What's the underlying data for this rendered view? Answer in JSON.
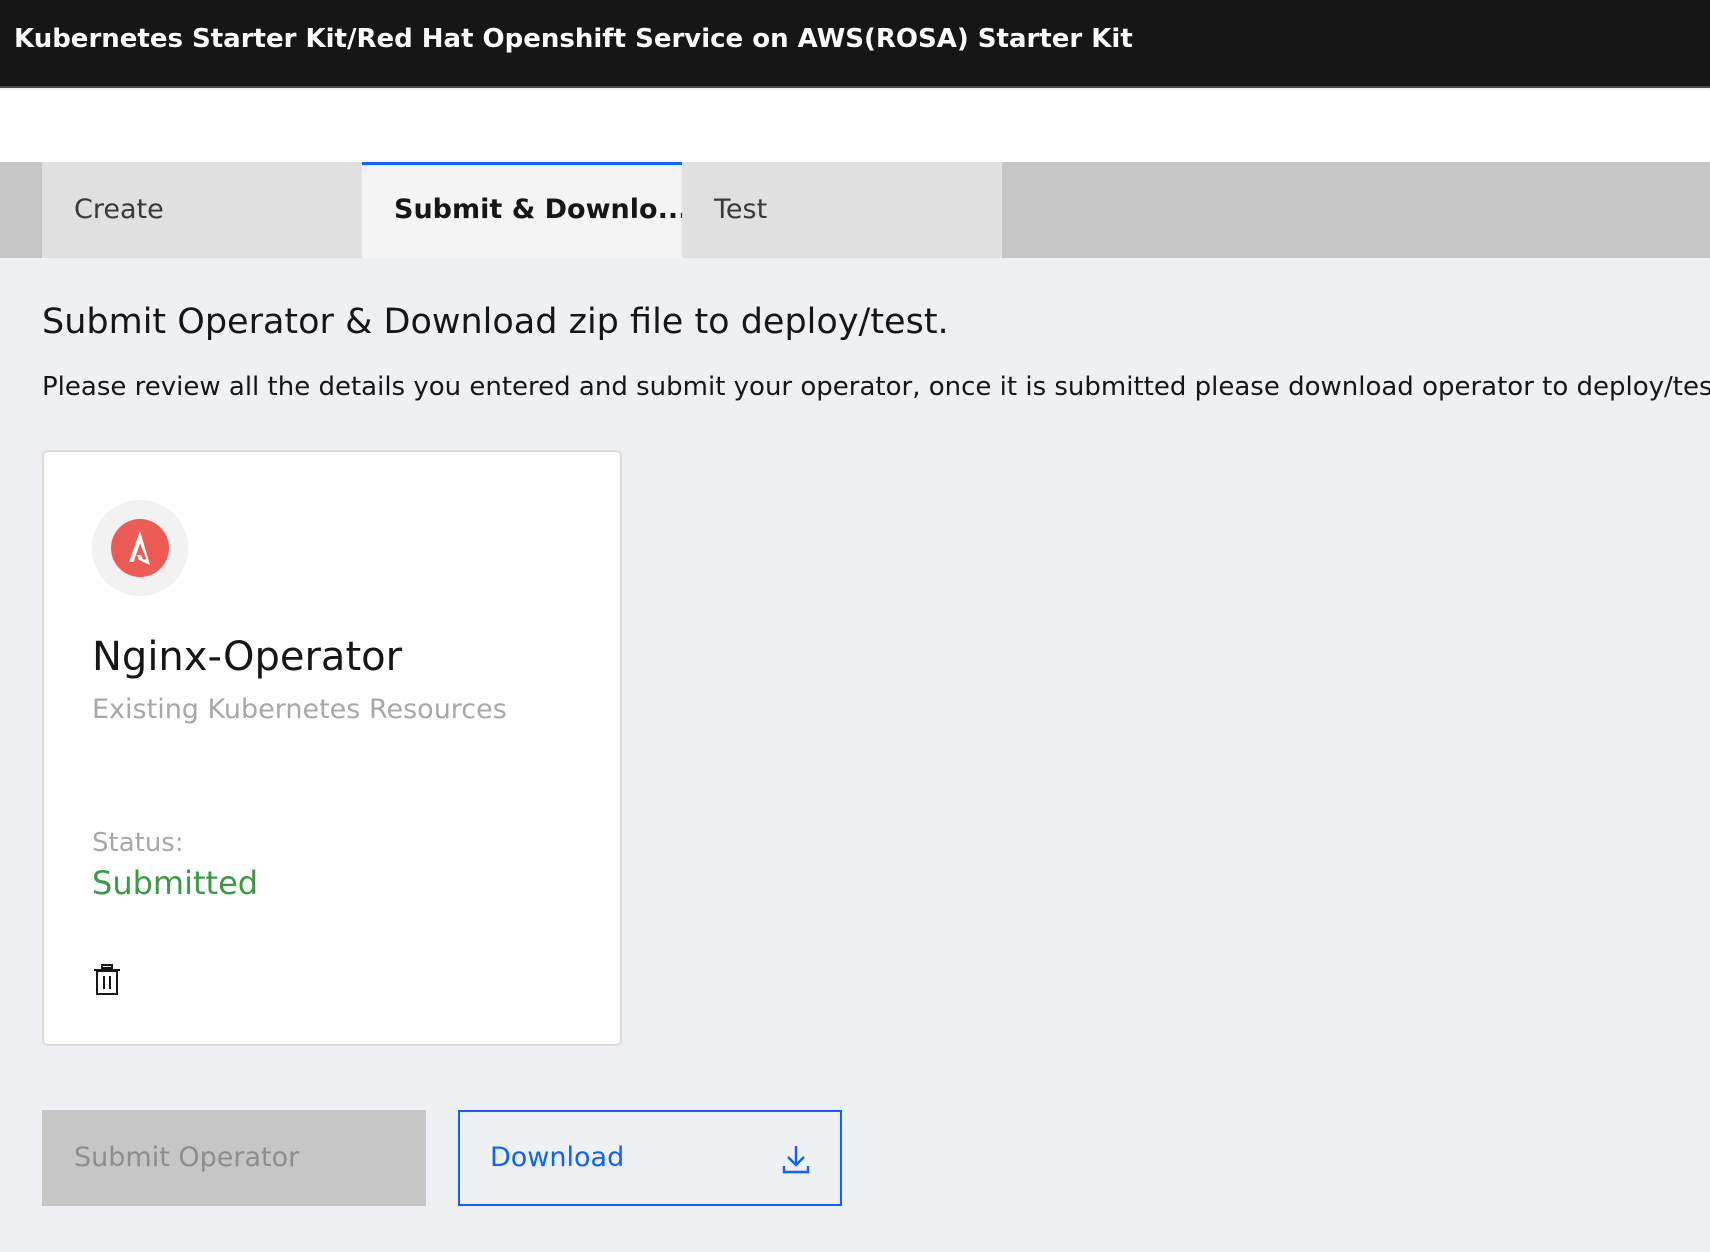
{
  "header": {
    "title": "Kubernetes Starter Kit/Red Hat Openshift Service on AWS(ROSA) Starter Kit"
  },
  "tabs": [
    {
      "label": "Create",
      "active": false
    },
    {
      "label": "Submit & Downlo...",
      "active": true
    },
    {
      "label": "Test",
      "active": false
    }
  ],
  "main": {
    "heading": "Submit Operator & Download zip file to deploy/test.",
    "description": "Please review all the details you entered and submit your operator, once it is submitted please download operator to deploy/test."
  },
  "card": {
    "logo_icon": "ansible-logo-icon",
    "title": "Nginx-Operator",
    "subtitle": "Existing Kubernetes Resources",
    "status_label": "Status:",
    "status_value": "Submitted",
    "delete_icon": "trash-icon"
  },
  "actions": {
    "submit_label": "Submit Operator",
    "submit_disabled": true,
    "download_label": "Download",
    "download_icon": "download-icon"
  },
  "colors": {
    "accent": "#0f62fe",
    "status_success": "#3a9b44",
    "logo_red": "#ee5b55"
  }
}
